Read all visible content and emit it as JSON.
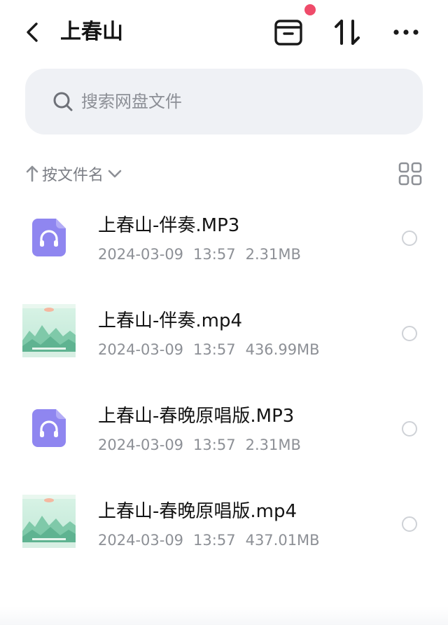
{
  "header": {
    "title": "上春山",
    "icons": {
      "back": "chevron-left-icon",
      "archive": "archive-box-icon",
      "sort": "transfer-arrows-icon",
      "more": "more-dots-icon"
    },
    "notification_dot_color": "#ef4b6a"
  },
  "search": {
    "placeholder": "搜索网盘文件",
    "icon": "search-icon"
  },
  "sort": {
    "label": "按文件名",
    "direction": "ascending",
    "view_toggle_icon": "grid-view-icon"
  },
  "files": [
    {
      "name": "上春山-伴奏.MP3",
      "date": "2024-03-09",
      "time": "13:57",
      "size": "2.31MB",
      "type": "audio"
    },
    {
      "name": "上春山-伴奏.mp4",
      "date": "2024-03-09",
      "time": "13:57",
      "size": "436.99MB",
      "type": "video"
    },
    {
      "name": "上春山-春晚原唱版.MP3",
      "date": "2024-03-09",
      "time": "13:57",
      "size": "2.31MB",
      "type": "audio"
    },
    {
      "name": "上春山-春晚原唱版.mp4",
      "date": "2024-03-09",
      "time": "13:57",
      "size": "437.01MB",
      "type": "video"
    }
  ],
  "colors": {
    "audio_icon": "#8f86f0",
    "search_bg": "#eff1f5",
    "meta_text": "#8d9096"
  }
}
